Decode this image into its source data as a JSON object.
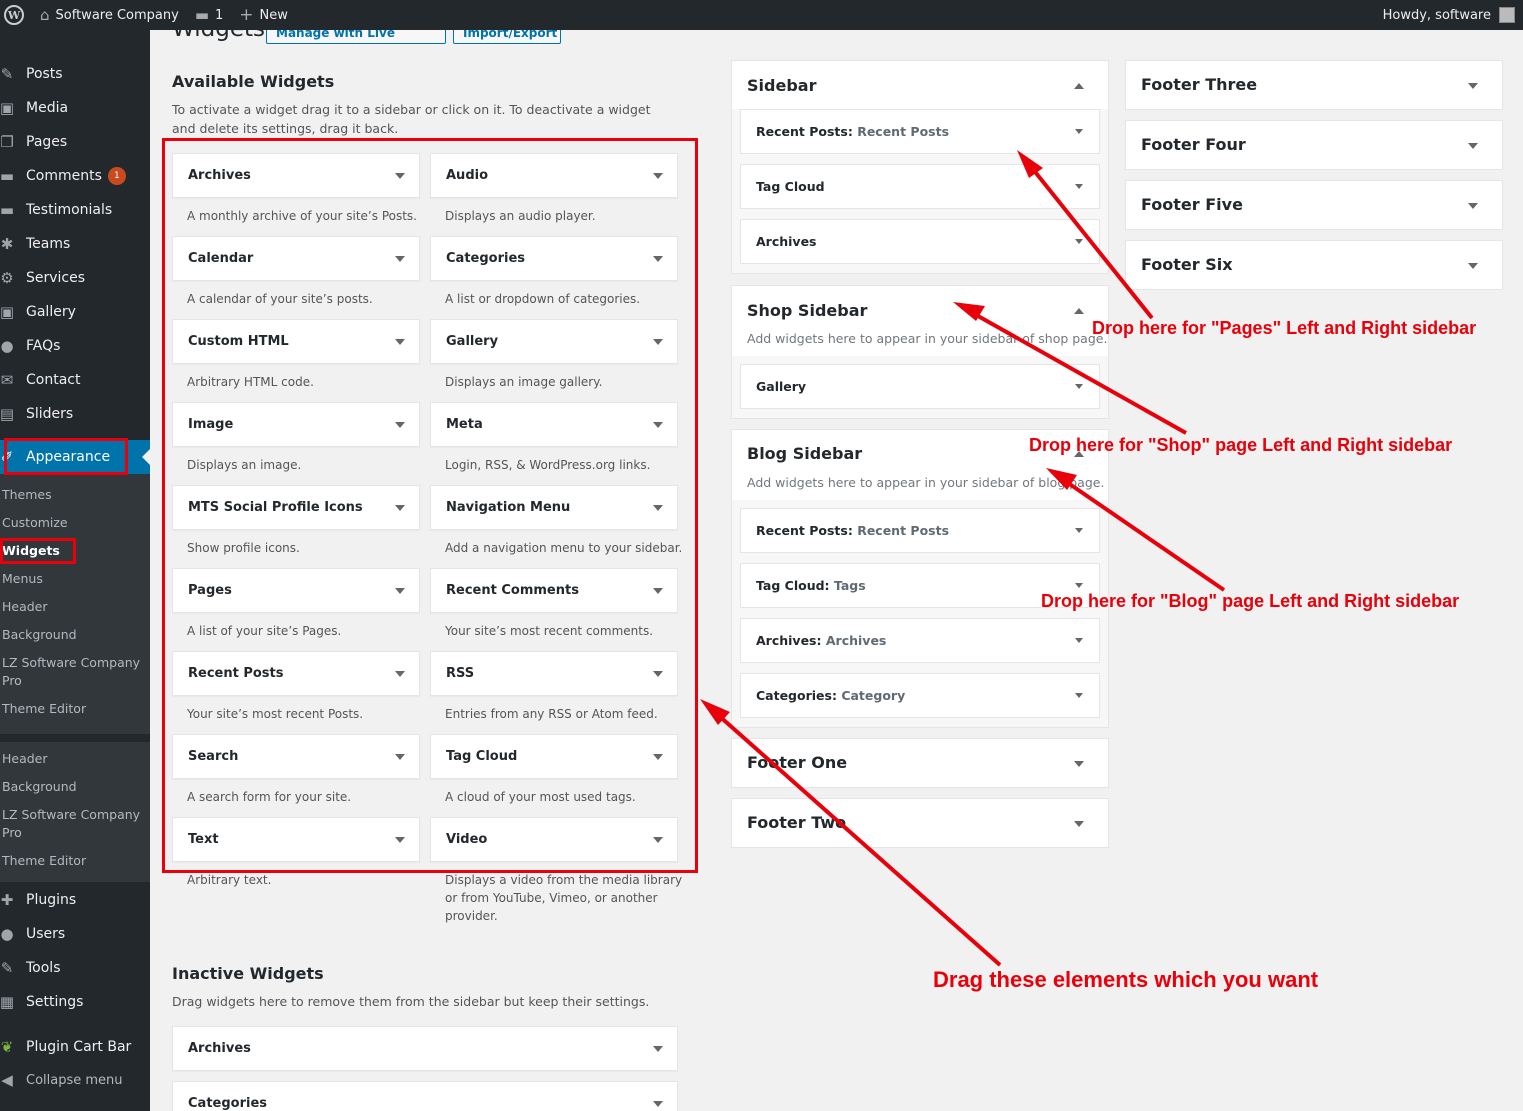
{
  "adminbar": {
    "site_name": "Software Company",
    "comments_count": "1",
    "new_label": "New",
    "greeting": "Howdy, software",
    "wp_logo": "W"
  },
  "menu": {
    "top_items": [
      {
        "label": "Posts",
        "icon": "pin-icon",
        "glyph": "✎"
      },
      {
        "label": "Media",
        "icon": "media-icon",
        "glyph": "▣"
      },
      {
        "label": "Pages",
        "icon": "pages-icon",
        "glyph": "❐"
      },
      {
        "label": "Comments",
        "icon": "comment-icon",
        "glyph": "▬",
        "badge": "1"
      },
      {
        "label": "Testimonials",
        "icon": "testimonials-icon",
        "glyph": "▬"
      },
      {
        "label": "Teams",
        "icon": "groups-icon",
        "glyph": "✱"
      },
      {
        "label": "Services",
        "icon": "services-icon",
        "glyph": "⚙"
      },
      {
        "label": "Gallery",
        "icon": "gallery-icon",
        "glyph": "▣"
      },
      {
        "label": "FAQs",
        "icon": "faq-icon",
        "glyph": "●"
      },
      {
        "label": "Contact",
        "icon": "mail-icon",
        "glyph": "✉"
      },
      {
        "label": "Sliders",
        "icon": "sliders-icon",
        "glyph": "▤"
      }
    ],
    "appearance": {
      "label": "Appearance",
      "icon": "brush-icon",
      "glyph": "✐"
    },
    "appearance_sub": [
      "Themes",
      "Customize",
      "Widgets",
      "Menus",
      "Header",
      "Background",
      "LZ Software Company Pro",
      "Theme Editor"
    ],
    "extra_sub": [
      "Header",
      "Background",
      "LZ Software Company Pro",
      "Theme Editor"
    ],
    "bottom_items": [
      {
        "label": "Plugins",
        "icon": "plugin-icon",
        "glyph": "✚"
      },
      {
        "label": "Users",
        "icon": "users-icon",
        "glyph": "●"
      },
      {
        "label": "Tools",
        "icon": "tools-icon",
        "glyph": "✎"
      },
      {
        "label": "Settings",
        "icon": "settings-icon",
        "glyph": "▦"
      },
      {
        "label": "Plugin Cart Bar",
        "icon": "leaf-icon",
        "glyph": "❦"
      },
      {
        "label": "Collapse menu",
        "icon": "collapse-icon",
        "glyph": "◀"
      }
    ]
  },
  "header": {
    "title": "Widgets",
    "manage_btn": "Manage with Live Preview",
    "import_btn": "Import/Export"
  },
  "available": {
    "heading": "Available Widgets",
    "description": "To activate a widget drag it to a sidebar or click on it. To deactivate a widget and delete its settings, drag it back.",
    "widgets": [
      {
        "title": "Archives",
        "desc": "A monthly archive of your site’s Posts."
      },
      {
        "title": "Audio",
        "desc": "Displays an audio player."
      },
      {
        "title": "Calendar",
        "desc": "A calendar of your site’s posts."
      },
      {
        "title": "Categories",
        "desc": "A list or dropdown of categories."
      },
      {
        "title": "Custom HTML",
        "desc": "Arbitrary HTML code."
      },
      {
        "title": "Gallery",
        "desc": "Displays an image gallery."
      },
      {
        "title": "Image",
        "desc": "Displays an image."
      },
      {
        "title": "Meta",
        "desc": "Login, RSS, & WordPress.org links."
      },
      {
        "title": "MTS Social Profile Icons",
        "desc": "Show profile icons."
      },
      {
        "title": "Navigation Menu",
        "desc": "Add a navigation menu to your sidebar."
      },
      {
        "title": "Pages",
        "desc": "A list of your site’s Pages."
      },
      {
        "title": "Recent Comments",
        "desc": "Your site’s most recent comments."
      },
      {
        "title": "Recent Posts",
        "desc": "Your site’s most recent Posts."
      },
      {
        "title": "RSS",
        "desc": "Entries from any RSS or Atom feed."
      },
      {
        "title": "Search",
        "desc": "A search form for your site."
      },
      {
        "title": "Tag Cloud",
        "desc": "A cloud of your most used tags."
      },
      {
        "title": "Text",
        "desc": "Arbitrary text."
      },
      {
        "title": "Video",
        "desc": "Displays a video from the media library or from YouTube, Vimeo, or another provider."
      }
    ]
  },
  "inactive": {
    "heading": "Inactive Widgets",
    "description": "Drag widgets here to remove them from the sidebar but keep their settings.",
    "widgets": [
      "Archives",
      "Categories"
    ]
  },
  "sidebars": {
    "sidebar": {
      "title": "Sidebar",
      "widgets": [
        {
          "title": "Recent Posts",
          "instance": "Recent Posts"
        },
        {
          "title": "Tag Cloud",
          "instance": ""
        },
        {
          "title": "Archives",
          "instance": ""
        }
      ]
    },
    "shop": {
      "title": "Shop Sidebar",
      "desc": "Add widgets here to appear in your sidebar of shop page.",
      "widgets": [
        {
          "title": "Gallery",
          "instance": ""
        }
      ]
    },
    "blog": {
      "title": "Blog Sidebar",
      "desc": "Add widgets here to appear in your sidebar of blog page.",
      "widgets": [
        {
          "title": "Recent Posts",
          "instance": "Recent Posts"
        },
        {
          "title": "Tag Cloud",
          "instance": "Tags"
        },
        {
          "title": "Archives",
          "instance": "Archives"
        },
        {
          "title": "Categories",
          "instance": "Category"
        }
      ]
    },
    "footer_one": "Footer One",
    "footer_two": "Footer Two",
    "footer_three": "Footer Three",
    "footer_four": "Footer Four",
    "footer_five": "Footer Five",
    "footer_six": "Footer Six"
  },
  "annotations": {
    "pages": "Drop here for \"Pages\" Left and Right sidebar",
    "shop": "Drop here for \"Shop\" page Left and Right sidebar",
    "blog": "Drop here for \"Blog\" page Left and Right sidebar",
    "drag": "Drag these elements which you want",
    "color": "#e8000b"
  },
  "colors": {
    "admin_dark": "#23282d",
    "submenu_bg": "#32373c",
    "current": "#0073aa",
    "badge": "#ca4a1f"
  }
}
